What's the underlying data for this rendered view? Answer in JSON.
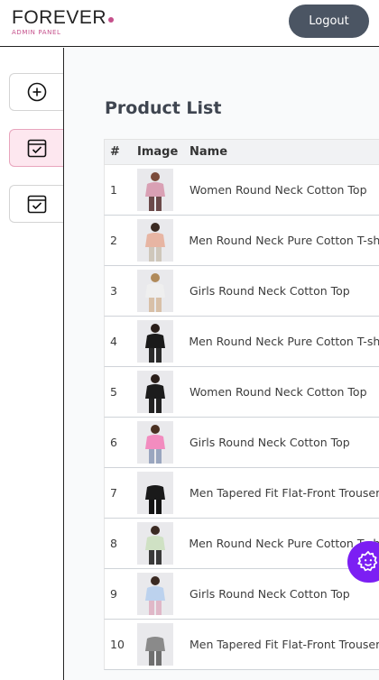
{
  "header": {
    "logo_text": "FOREVER",
    "logo_sub": "ADMIN PANEL",
    "logout_label": "Logout"
  },
  "sidebar": {
    "items": [
      {
        "icon": "add-circle-icon",
        "active": false
      },
      {
        "icon": "calendar-check-icon",
        "active": true
      },
      {
        "icon": "calendar-check-icon",
        "active": false
      }
    ]
  },
  "main": {
    "title": "Product List",
    "columns": [
      "#",
      "Image",
      "Name"
    ],
    "rows": [
      {
        "num": "1",
        "name": "Women Round Neck Cotton Top",
        "thumb": "woman-floral-top"
      },
      {
        "num": "2",
        "name": "Men Round Neck Pure Cotton T-shirt",
        "thumb": "man-peach-shirt"
      },
      {
        "num": "3",
        "name": "Girls Round Neck Cotton Top",
        "thumb": "girl-white-dress"
      },
      {
        "num": "4",
        "name": "Men Round Neck Pure Cotton T-shirt",
        "thumb": "man-black-tee"
      },
      {
        "num": "5",
        "name": "Women Round Neck Cotton Top",
        "thumb": "woman-black-tee"
      },
      {
        "num": "6",
        "name": "Girls Round Neck Cotton Top",
        "thumb": "girl-pink-top"
      },
      {
        "num": "7",
        "name": "Men Tapered Fit Flat-Front Trousers",
        "thumb": "man-black-trousers"
      },
      {
        "num": "8",
        "name": "Men Round Neck Pure Cotton T-shirt",
        "thumb": "boy-striped-tee"
      },
      {
        "num": "9",
        "name": "Girls Round Neck Cotton Top",
        "thumb": "girl-blue-top"
      },
      {
        "num": "10",
        "name": "Men Tapered Fit Flat-Front Trousers",
        "thumb": "man-grey-joggers"
      }
    ]
  },
  "colors": {
    "accent_pink": "#c5508b",
    "logout_bg": "#4b5563",
    "active_bg": "#fde7ef",
    "fab_bg": "#7c1ff3"
  }
}
